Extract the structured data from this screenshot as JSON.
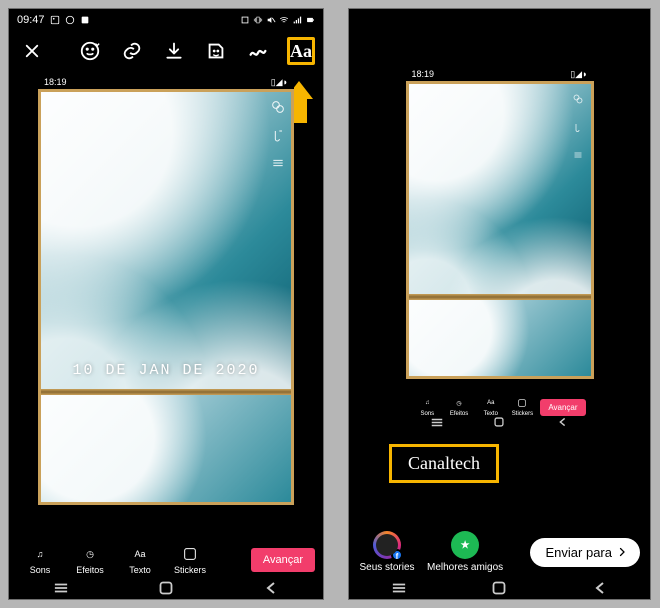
{
  "status": {
    "time_left": "09:47",
    "time_inner": "18:19"
  },
  "toolbar": {
    "close": "✕",
    "text_tool_label": "Aa"
  },
  "date_stamp": "10 DE JAN DE 2020",
  "editor_tabs": {
    "sons": "Sons",
    "efeitos": "Efeitos",
    "texto": "Texto",
    "stickers": "Stickers",
    "avancar": "Avançar",
    "aa": "Aa"
  },
  "callout": {
    "brand": "Canaltech"
  },
  "share": {
    "your_stories": "Seus stories",
    "best_friends": "Melhores amigos",
    "send_to": "Enviar para",
    "star": "★",
    "fb": "f"
  },
  "icons": {
    "music": "♫",
    "clock": "◷"
  }
}
